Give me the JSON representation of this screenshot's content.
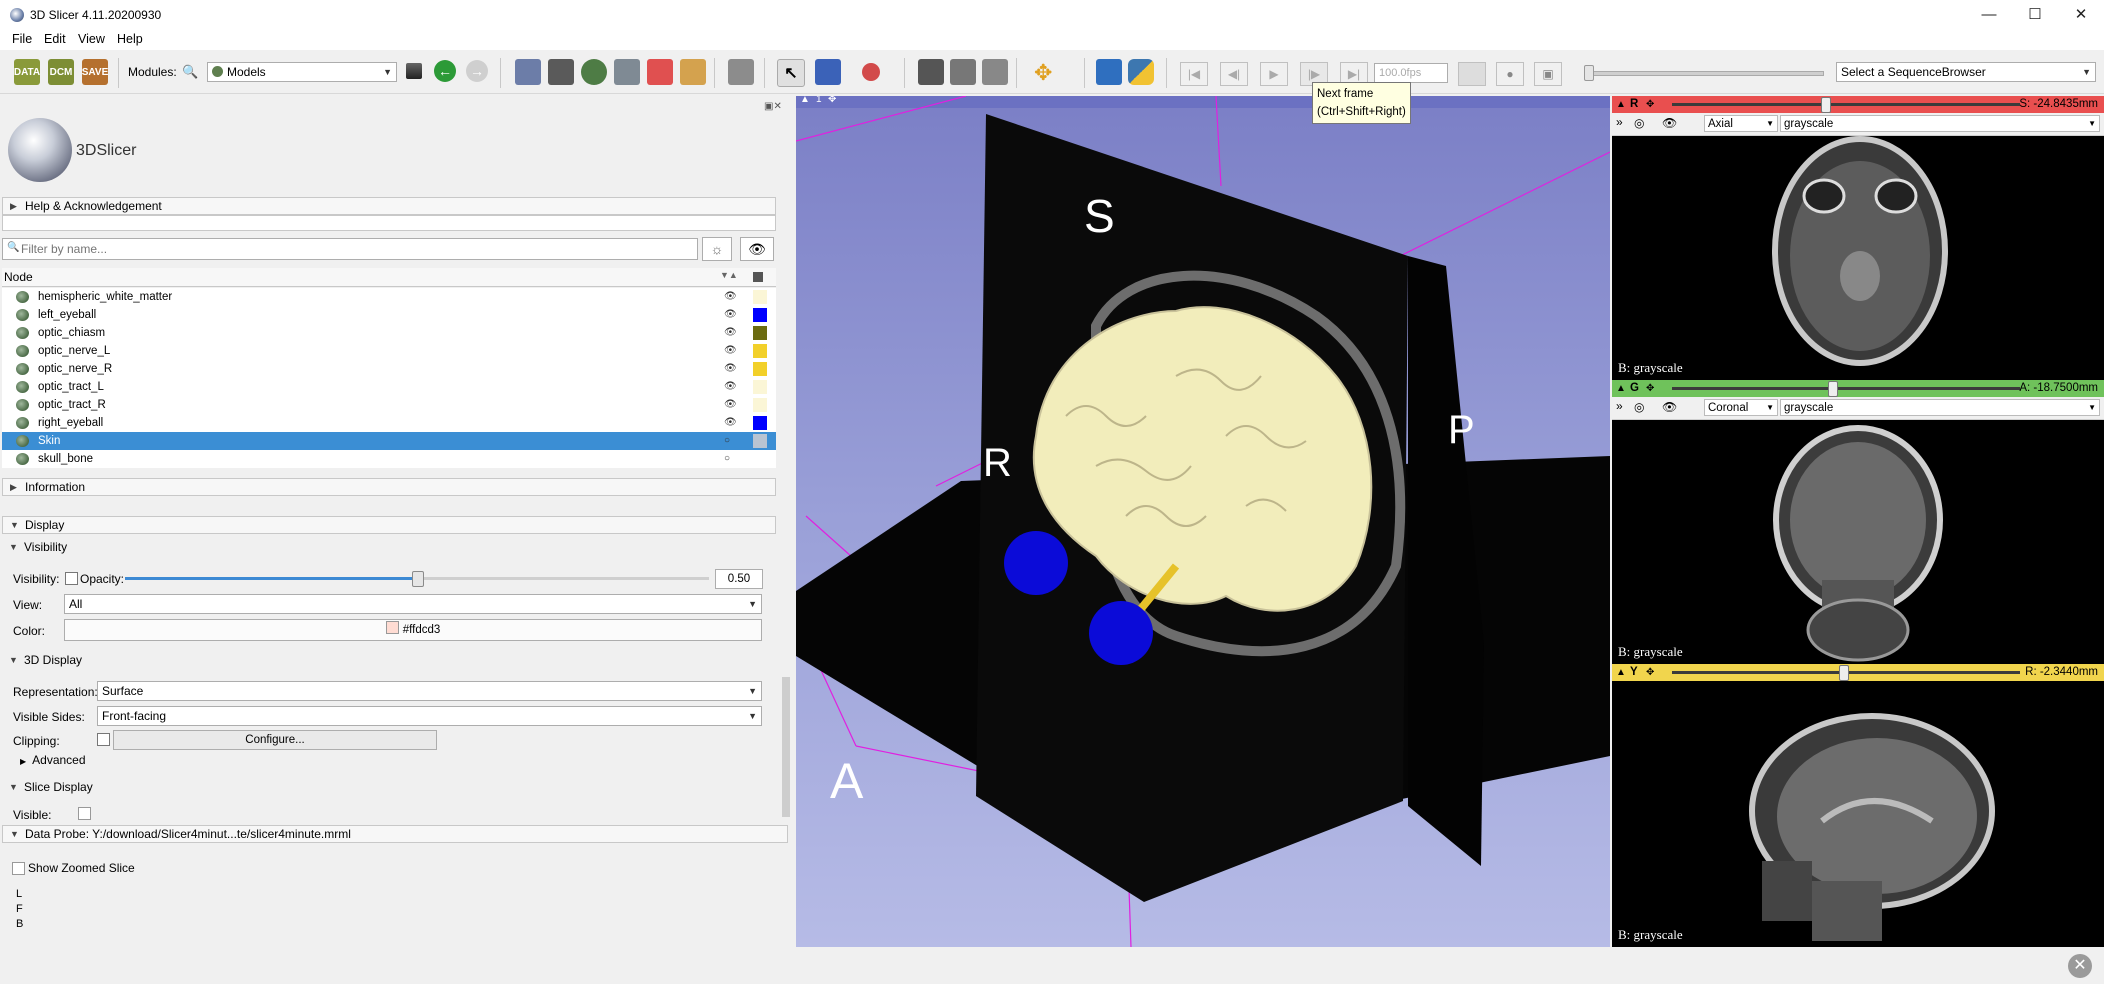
{
  "window": {
    "title": "3D Slicer 4.11.20200930",
    "minimize": "—",
    "maximize": "☐",
    "close": "✕"
  },
  "menu": [
    {
      "label": "File"
    },
    {
      "label": "Edit"
    },
    {
      "label": "View"
    },
    {
      "label": "Help"
    }
  ],
  "toolbar": {
    "data_label": "DATA",
    "dcm_label": "DCM",
    "save_label": "SAVE",
    "modules_label": "Modules:",
    "module_selected": "Models",
    "fps_value": "100.0fps",
    "sequence_browser": "Select a SequenceBrowser"
  },
  "tooltip": {
    "line1": "Next frame",
    "line2": "(Ctrl+Shift+Right)"
  },
  "logo": {
    "text": "3DSlicer"
  },
  "sections": {
    "help": "Help & Acknowledgement",
    "information": "Information",
    "display": "Display",
    "visibility": "Visibility",
    "display3d": "3D Display",
    "advanced": "Advanced",
    "slice_display": "Slice Display",
    "data_probe": "Data Probe: Y:/download/Slicer4minut...te/slicer4minute.mrml"
  },
  "filter": {
    "placeholder": "Filter by name..."
  },
  "tree": {
    "header": "Node",
    "nodes": [
      {
        "label": "hemispheric_white_matter",
        "color": "#fbf6d6",
        "visible": true,
        "selected": false
      },
      {
        "label": "left_eyeball",
        "color": "#0000ff",
        "visible": true,
        "selected": false
      },
      {
        "label": "optic_chiasm",
        "color": "#6b6b10",
        "visible": true,
        "selected": false
      },
      {
        "label": "optic_nerve_L",
        "color": "#f2d02a",
        "visible": true,
        "selected": false
      },
      {
        "label": "optic_nerve_R",
        "color": "#f2d02a",
        "visible": true,
        "selected": false
      },
      {
        "label": "optic_tract_L",
        "color": "#fbf6d6",
        "visible": true,
        "selected": false
      },
      {
        "label": "optic_tract_R",
        "color": "#fbf6d6",
        "visible": true,
        "selected": false
      },
      {
        "label": "right_eyeball",
        "color": "#0000ff",
        "visible": true,
        "selected": false
      },
      {
        "label": "Skin",
        "color": "#b9c4d2",
        "visible": false,
        "selected": true
      },
      {
        "label": "skull_bone",
        "color": "",
        "visible": false,
        "selected": false
      }
    ]
  },
  "display": {
    "visibility_label": "Visibility:",
    "opacity_label": "Opacity:",
    "opacity_value": "0.50",
    "opacity_fraction": 0.5,
    "view_label": "View:",
    "view_value": "All",
    "color_label": "Color:",
    "color_value": "#ffdcd3",
    "representation_label": "Representation:",
    "representation_value": "Surface",
    "visible_sides_label": "Visible Sides:",
    "visible_sides_value": "Front-facing",
    "clipping_label": "Clipping:",
    "configure_label": "Configure...",
    "slice_visible_label": "Visible:"
  },
  "probe": {
    "show_zoomed": "Show Zoomed Slice",
    "lines": [
      "L",
      "F",
      "B"
    ]
  },
  "view3d": {
    "index": "1",
    "orient_s": "S",
    "orient_r": "R",
    "orient_p": "P",
    "orient_a": "A"
  },
  "slices": [
    {
      "letter": "R",
      "offset": "S: -24.8435mm",
      "orientation": "Axial",
      "volume": "grayscale",
      "caption": "B: grayscale",
      "bar_color": "#e94f4f",
      "slider_fraction": 0.44
    },
    {
      "letter": "G",
      "offset": "A: -18.7500mm",
      "orientation": "Coronal",
      "volume": "grayscale",
      "caption": "B: grayscale",
      "bar_color": "#6fc25b",
      "slider_fraction": 0.46
    },
    {
      "letter": "Y",
      "offset": "R: -2.3440mm",
      "orientation": "",
      "volume": "",
      "caption": "B: grayscale",
      "bar_color": "#f1d54d",
      "slider_fraction": 0.49
    }
  ]
}
